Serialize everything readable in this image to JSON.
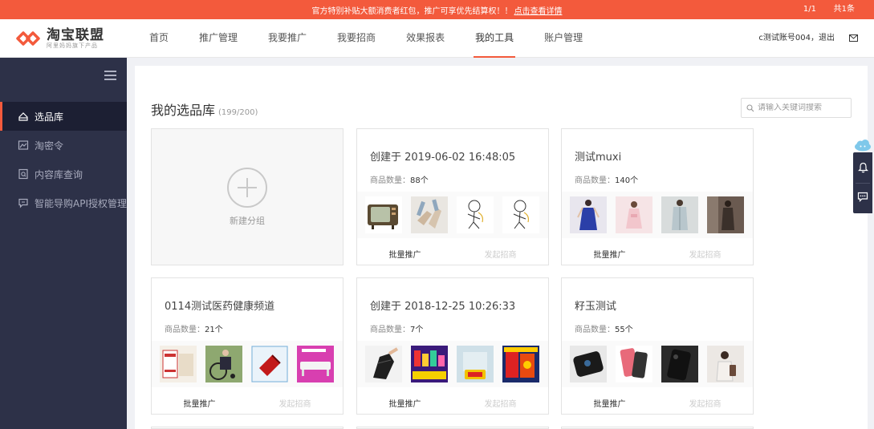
{
  "banner": {
    "message": "官方特别补贴大额消费者红包，推广可享优先结算权！！",
    "link": "点击查看详情",
    "pager": "1/1",
    "total": "共1条"
  },
  "header": {
    "logo_title": "淘宝联盟",
    "logo_sub": "阿里妈妈旗下产品",
    "nav": [
      "首页",
      "推广管理",
      "我要推广",
      "我要招商",
      "效果报表",
      "我的工具",
      "账户管理"
    ],
    "active_nav": "我的工具",
    "account": "c测试账号004，退出"
  },
  "sidebar": {
    "items": [
      "选品库",
      "淘密令",
      "内容库查询",
      "智能导购API授权管理"
    ]
  },
  "main": {
    "title": "我的选品库",
    "count": "(199/200)",
    "search_placeholder": "请输入关键词搜索",
    "new_group": "新建分组",
    "qty_label": "商品数量：",
    "batch_label": "批量推广",
    "invite_label": "发起招商",
    "groups": [
      {
        "title": "创建于 2019-06-02 16:48:05",
        "qty": "88个"
      },
      {
        "title": "测试muxi",
        "qty": "140个"
      },
      {
        "title": "0114测试医药健康频道",
        "qty": "21个"
      },
      {
        "title": "创建于 2018-12-25 10:26:33",
        "qty": "7个"
      },
      {
        "title": "籽玉测试",
        "qty": "55个"
      }
    ]
  },
  "colors": {
    "accent": "#f35a3c",
    "sidebar_bg": "#2d3148",
    "sidebar_active": "#1c1f33"
  }
}
